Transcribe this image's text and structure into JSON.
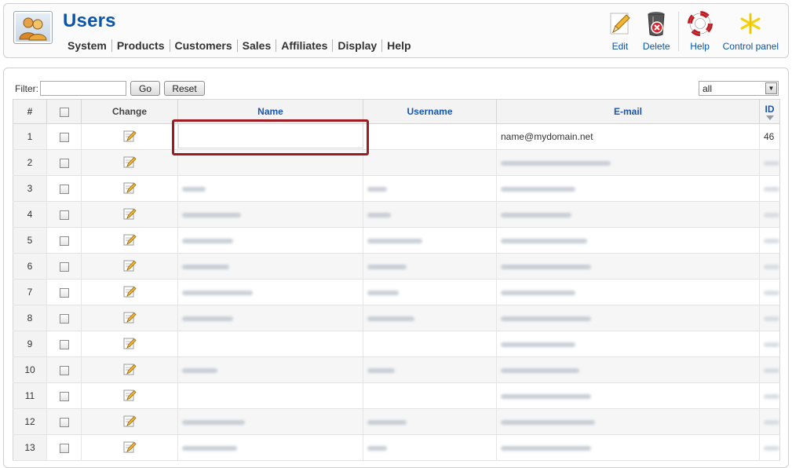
{
  "header": {
    "title": "Users",
    "logo_icon": "users-icon",
    "nav": [
      "System",
      "Products",
      "Customers",
      "Sales",
      "Affiliates",
      "Display",
      "Help"
    ],
    "toolbar": [
      {
        "label": "Edit",
        "icon": "pencil-icon"
      },
      {
        "label": "Delete",
        "icon": "trash-icon"
      },
      {
        "label": "Help",
        "icon": "lifebuoy-icon"
      },
      {
        "label": "Control panel",
        "icon": "sparkle-icon"
      }
    ]
  },
  "filter": {
    "label": "Filter:",
    "value": "",
    "go_label": "Go",
    "reset_label": "Reset",
    "page_size_selected": "all"
  },
  "table": {
    "columns": {
      "index": "#",
      "change": "Change",
      "name": "Name",
      "username": "Username",
      "email": "E-mail",
      "id": "ID"
    },
    "rows": [
      {
        "index": "1",
        "email": "name@mydomain.net",
        "id": "46"
      },
      {
        "index": "2"
      },
      {
        "index": "3"
      },
      {
        "index": "4"
      },
      {
        "index": "5"
      },
      {
        "index": "6"
      },
      {
        "index": "7"
      },
      {
        "index": "8"
      },
      {
        "index": "9"
      },
      {
        "index": "10"
      },
      {
        "index": "11"
      },
      {
        "index": "12"
      },
      {
        "index": "13"
      }
    ]
  },
  "colors": {
    "title": "#0b55a8",
    "highlight": "#9b1d22"
  }
}
